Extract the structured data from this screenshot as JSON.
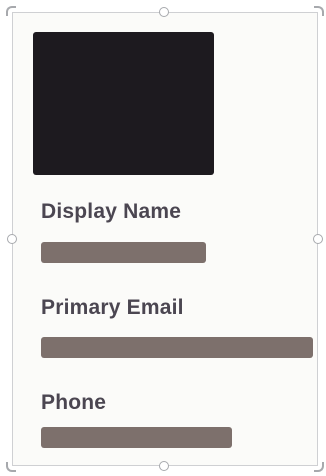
{
  "profile_card": {
    "fields": {
      "display_name": {
        "label": "Display Name"
      },
      "primary_email": {
        "label": "Primary Email"
      },
      "phone": {
        "label": "Phone"
      }
    }
  },
  "colors": {
    "photo_placeholder": "#1d1a1f",
    "value_placeholder": "#7d706c",
    "label_text": "#4b4651",
    "selection_frame": "#cfd0d3"
  }
}
